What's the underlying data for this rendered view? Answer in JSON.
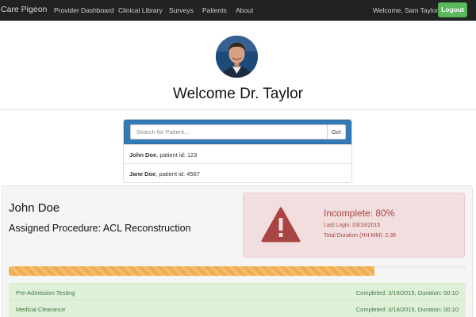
{
  "navbar": {
    "brand": "Care Pigeon",
    "items": [
      "Provider Dashboard",
      "Clinical Library",
      "Surveys",
      "Patients",
      "About"
    ],
    "welcome": "Welcome, Sam Taylor",
    "logout_label": "Logout"
  },
  "header": {
    "title": "Welcome Dr. Taylor"
  },
  "search": {
    "placeholder": "Search for Patient...",
    "button_label": "Go!",
    "results": [
      {
        "name": "John Doe",
        "detail": ", patient id: 123"
      },
      {
        "name": "Jane Doe",
        "detail": ", patient id: 4567"
      }
    ]
  },
  "patient": {
    "name": "John Doe",
    "procedure": "Assigned Procedure: ACL Reconstruction",
    "status_title": "Incomplete: 80%",
    "last_login": "Last Login: 03/18/2015",
    "total_duration": "Total Duration (HH:MM): 2:36",
    "progress_percent": 80,
    "steps": [
      {
        "name": "Pre-Admission Testing",
        "status": "Completed: 3/18/2015, Duration: 00:10"
      },
      {
        "name": "Medical Clearance",
        "status": "Completed: 3/18/2015, Duration: 00:10"
      }
    ]
  },
  "colors": {
    "navbar": "#222222",
    "logout": "#5cb85c",
    "search_header": "#337ab7",
    "alert_bg": "#f2dede",
    "alert_text": "#a94442",
    "progress": "#f0ad4e",
    "step_bg": "#dff0d8"
  }
}
